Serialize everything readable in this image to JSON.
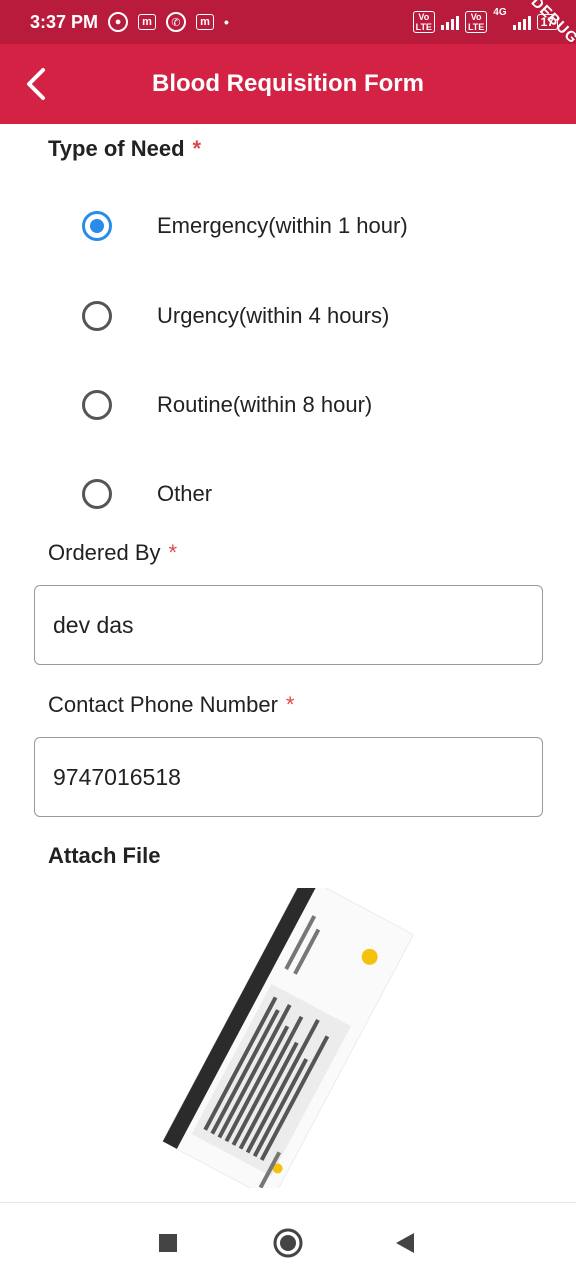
{
  "status_bar": {
    "time": "3:37 PM",
    "net_4g": "4G",
    "lte_label": "LTE",
    "vo_label": "Vo",
    "battery": "17",
    "debug_ribbon": "DEBUG"
  },
  "app_bar": {
    "title": "Blood Requisition Form"
  },
  "form": {
    "type_of_need": {
      "label": "Type of Need",
      "required_mark": "*",
      "options": [
        {
          "label": "Emergency(within 1 hour)",
          "selected": true
        },
        {
          "label": "Urgency(within 4 hours)",
          "selected": false
        },
        {
          "label": "Routine(within 8 hour)",
          "selected": false
        },
        {
          "label": "Other",
          "selected": false
        }
      ]
    },
    "ordered_by": {
      "label": "Ordered By",
      "required_mark": "*",
      "value": "dev das"
    },
    "contact_phone": {
      "label": "Contact Phone Number",
      "required_mark": "*",
      "value": "9747016518"
    },
    "attach_file": {
      "label": "Attach File"
    }
  },
  "colors": {
    "status_bar": "#b81b3b",
    "app_bar": "#d32243",
    "radio_selected": "#2a8ce8",
    "required": "#e04848"
  },
  "icons": {
    "back": "chevron-left-icon",
    "nav_recents": "square-icon",
    "nav_home": "circle-icon",
    "nav_back": "triangle-left-icon"
  }
}
